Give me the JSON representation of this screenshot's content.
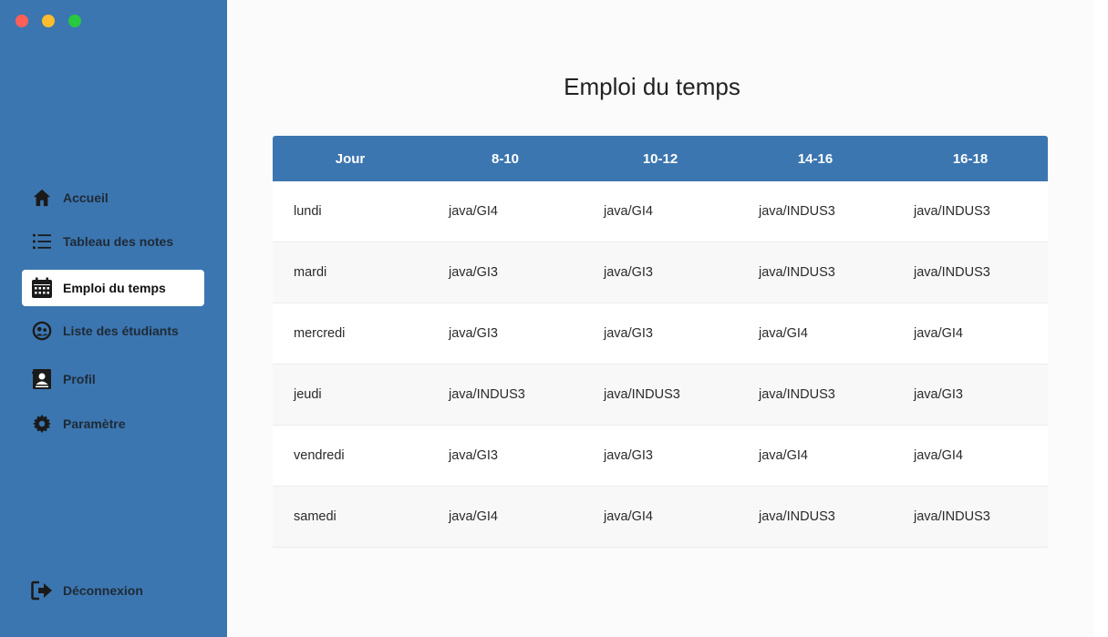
{
  "sidebar": {
    "items": [
      {
        "label": "Accueil",
        "icon": "home-icon"
      },
      {
        "label": "Tableau des notes",
        "icon": "list-icon"
      },
      {
        "label": "Emploi du temps",
        "icon": "calendar-icon",
        "active": true
      },
      {
        "label": "Liste des étudiants",
        "icon": "students-icon"
      },
      {
        "label": "Profil",
        "icon": "profile-icon"
      },
      {
        "label": "Paramètre",
        "icon": "gear-icon"
      }
    ],
    "logout": {
      "label": "Déconnexion",
      "icon": "logout-icon"
    }
  },
  "main": {
    "title": "Emploi du temps",
    "table": {
      "headers": [
        "Jour",
        "8-10",
        "10-12",
        "14-16",
        "16-18"
      ],
      "rows": [
        [
          "lundi",
          "java/GI4",
          "java/GI4",
          "java/INDUS3",
          "java/INDUS3"
        ],
        [
          "mardi",
          "java/GI3",
          "java/GI3",
          "java/INDUS3",
          "java/INDUS3"
        ],
        [
          "mercredi",
          "java/GI3",
          "java/GI3",
          "java/GI4",
          "java/GI4"
        ],
        [
          "jeudi",
          "java/INDUS3",
          "java/INDUS3",
          "java/INDUS3",
          "java/GI3"
        ],
        [
          "vendredi",
          "java/GI3",
          "java/GI3",
          "java/GI4",
          "java/GI4"
        ],
        [
          "samedi",
          "java/GI4",
          "java/GI4",
          "java/INDUS3",
          "java/INDUS3"
        ]
      ]
    }
  },
  "colors": {
    "sidebar": "#3c76b0",
    "header": "#3c76b0",
    "active_bg": "#ffffff"
  }
}
